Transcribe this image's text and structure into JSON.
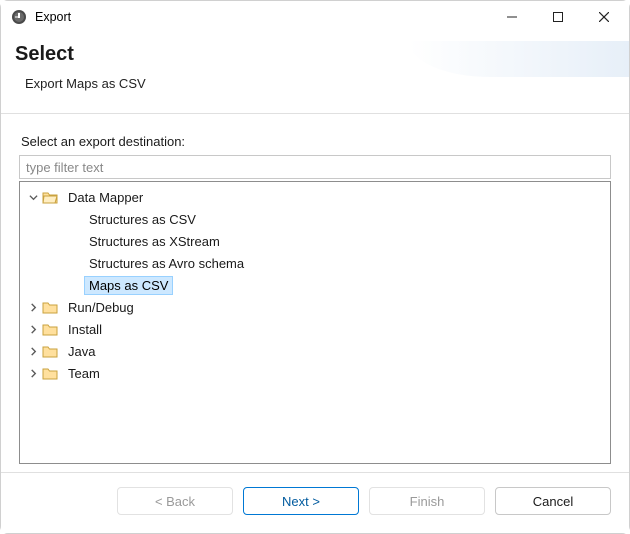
{
  "window": {
    "title": "Export"
  },
  "header": {
    "heading": "Select",
    "subtitle": "Export Maps as CSV"
  },
  "content": {
    "prompt": "Select an export destination:",
    "filter_placeholder": "type filter text"
  },
  "tree": {
    "data_mapper": {
      "label": "Data Mapper",
      "children": {
        "structures_csv": "Structures as CSV",
        "structures_xstream": "Structures as XStream",
        "structures_avro": "Structures as Avro schema",
        "maps_csv": "Maps as CSV"
      }
    },
    "run_debug": {
      "label": "Run/Debug"
    },
    "install": {
      "label": "Install"
    },
    "java": {
      "label": "Java"
    },
    "team": {
      "label": "Team"
    }
  },
  "buttons": {
    "back": "< Back",
    "next": "Next >",
    "finish": "Finish",
    "cancel": "Cancel"
  }
}
